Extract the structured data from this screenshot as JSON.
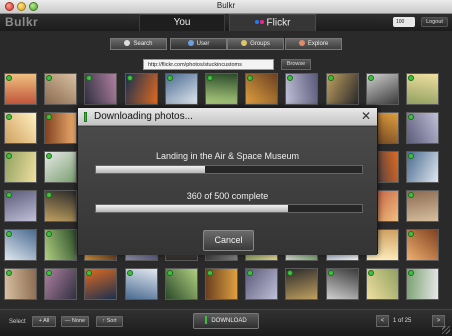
{
  "window": {
    "title": "Bulkr"
  },
  "header": {
    "logo": "Bulkr",
    "tabs": [
      {
        "label": "You",
        "active": false
      },
      {
        "label": "Flickr",
        "active": true
      }
    ],
    "zoom_value": "100",
    "logout_label": "Logout"
  },
  "search_tabs": [
    {
      "label": "Search",
      "icon": "search-icon"
    },
    {
      "label": "User",
      "icon": "user-icon",
      "active": true
    },
    {
      "label": "Groups",
      "icon": "groups-icon"
    },
    {
      "label": "Explore",
      "icon": "explore-icon"
    }
  ],
  "url_field": {
    "value": "http://flickr.com/photos/stuckincustoms"
  },
  "browse_label": "Browse",
  "grid": {
    "columns": 11,
    "rows": 6,
    "all_selected": true
  },
  "dialog": {
    "title": "Downloading photos...",
    "photo_name": "Landing in the Air & Space Museum",
    "photo_progress": 0.41,
    "count_text": "360 of 500 complete",
    "count_progress": 0.72,
    "cancel_label": "Cancel"
  },
  "toolbar": {
    "select_label": "Select",
    "all_label": "+ All",
    "none_label": "— None",
    "sort_label": "↑ Sort",
    "download_label": "DOWNLOAD",
    "prev_label": "<",
    "page_text": "1 of 25",
    "next_label": ">"
  },
  "colors": {
    "accent_green": "#3cbf3c",
    "flickr_blue": "#1a7ff0",
    "flickr_pink": "#ff1f8a"
  }
}
